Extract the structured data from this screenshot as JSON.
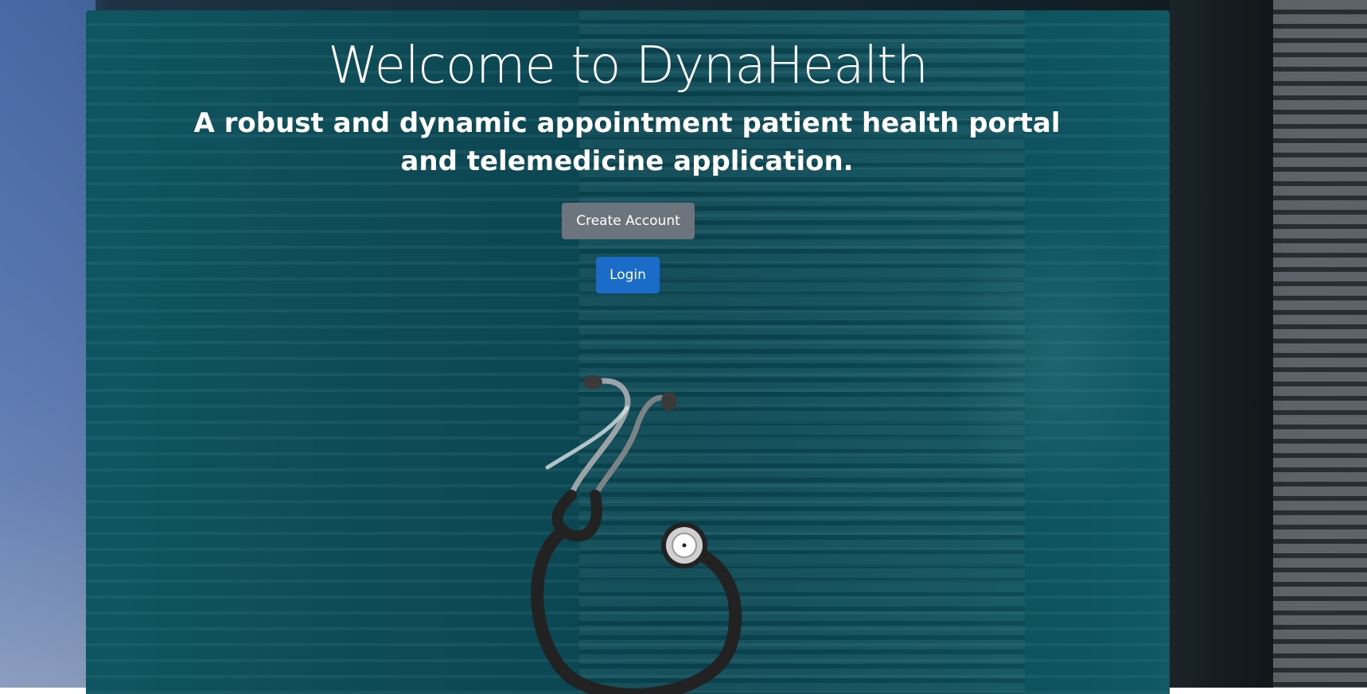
{
  "hero": {
    "title": "Welcome to DynaHealth",
    "subtitle": "A robust and dynamic appointment patient health portal and telemedicine application."
  },
  "actions": {
    "create_account_label": "Create Account",
    "login_label": "Login"
  },
  "colors": {
    "panel": "#0c4c58",
    "create_button": "#6c757d",
    "login_button": "#1a6cc8",
    "text": "#ffffff"
  },
  "icons": {
    "illustration": "stethoscope-icon"
  }
}
